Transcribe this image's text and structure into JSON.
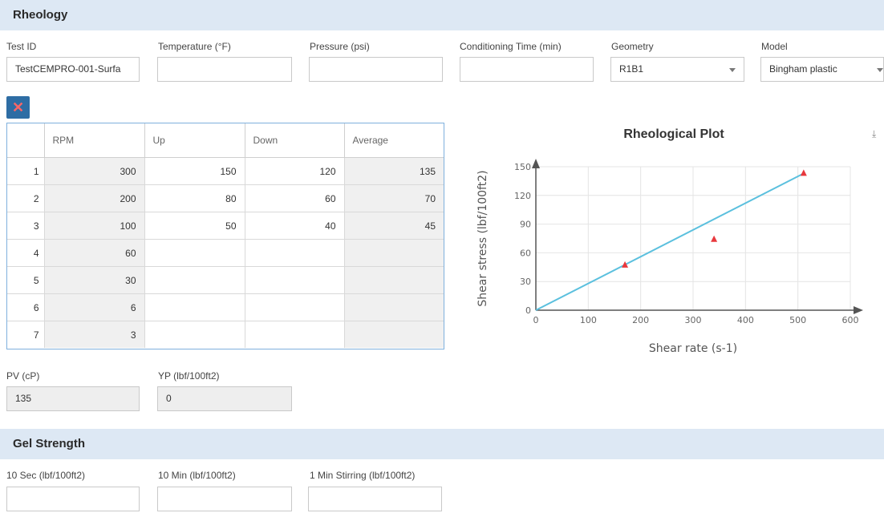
{
  "rheology": {
    "title": "Rheology",
    "fields": [
      {
        "label": "Test ID",
        "value": "TestCEMPRO-001-Surfa"
      },
      {
        "label": "Temperature (°F)",
        "value": ""
      },
      {
        "label": "Pressure (psi)",
        "value": ""
      },
      {
        "label": "Conditioning Time (min)",
        "value": ""
      },
      {
        "label": "Geometry",
        "value": "R1B1"
      },
      {
        "label": "Model",
        "value": "Bingham plastic"
      }
    ],
    "delete_icon": "close-icon",
    "table": {
      "headers": [
        "",
        "RPM",
        "Up",
        "Down",
        "Average"
      ],
      "rows": [
        [
          "1",
          "300",
          "150",
          "120",
          "135"
        ],
        [
          "2",
          "200",
          "80",
          "60",
          "70"
        ],
        [
          "3",
          "100",
          "50",
          "40",
          "45"
        ],
        [
          "4",
          "60",
          "",
          "",
          ""
        ],
        [
          "5",
          "30",
          "",
          "",
          ""
        ],
        [
          "6",
          "6",
          "",
          "",
          ""
        ],
        [
          "7",
          "3",
          "",
          "",
          ""
        ]
      ]
    },
    "pv": {
      "label": "PV (cP)",
      "value": "135"
    },
    "yp": {
      "label": "YP (lbf/100ft2)",
      "value": "0"
    }
  },
  "chart_data": {
    "type": "scatter",
    "title": "Rheological Plot",
    "xlabel": "Shear rate (s-1)",
    "ylabel": "Shear stress (lbf/100ft2)",
    "xlim": [
      0,
      600
    ],
    "ylim": [
      0,
      150
    ],
    "xticks": [
      0,
      100,
      200,
      300,
      400,
      500,
      600
    ],
    "yticks": [
      0,
      30,
      60,
      90,
      120,
      150
    ],
    "grid": true,
    "points": [
      {
        "x": 170,
        "y": 47
      },
      {
        "x": 340,
        "y": 74
      },
      {
        "x": 511,
        "y": 143
      }
    ],
    "fit_line": {
      "x": [
        0,
        511
      ],
      "y": [
        0,
        143
      ]
    },
    "point_color": "#e8383d",
    "line_color": "#5bc0de"
  },
  "gel_strength": {
    "title": "Gel Strength",
    "fields": [
      {
        "label": "10 Sec (lbf/100ft2)",
        "value": ""
      },
      {
        "label": "10 Min (lbf/100ft2)",
        "value": ""
      },
      {
        "label": "1 Min Stirring (lbf/100ft2)",
        "value": ""
      }
    ]
  }
}
